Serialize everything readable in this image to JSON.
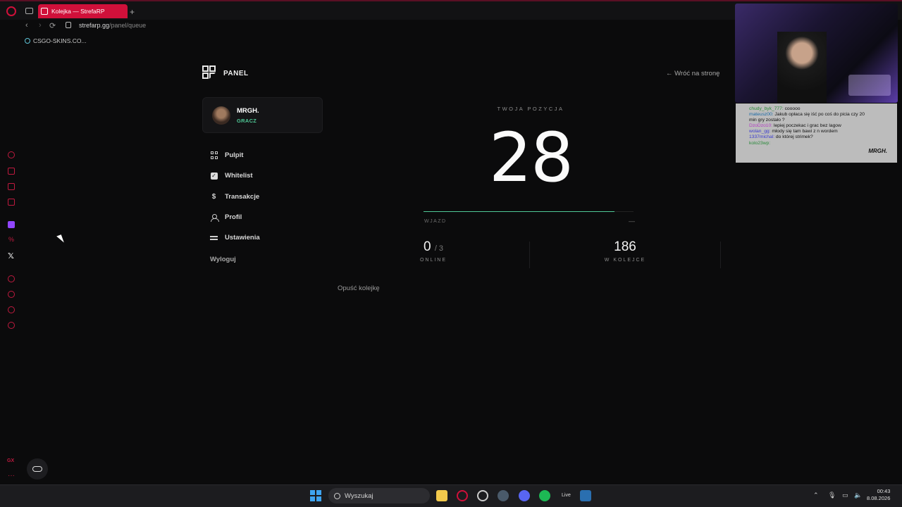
{
  "browser": {
    "tab_title": "Kolejka — StrefaRP",
    "new_tab_symbol": "+",
    "url_domain": "strefarp.gg",
    "url_path": "/panel/queue",
    "bookmark": "CSGO-SKINS.CO..."
  },
  "panel": {
    "brand": "PANEL",
    "back_link": "← Wróć na stronę",
    "user": {
      "name": "MRGH.",
      "role": "GRACZ"
    },
    "menu": [
      {
        "label": "Pulpit",
        "icon": "grid-icon"
      },
      {
        "label": "Whitelist",
        "icon": "checkbox-icon"
      },
      {
        "label": "Transakcje",
        "icon": "dollar-icon"
      },
      {
        "label": "Profil",
        "icon": "user-icon"
      },
      {
        "label": "Ustawienia",
        "icon": "sliders-icon"
      }
    ],
    "logout": "Wyloguj"
  },
  "queue": {
    "position_label": "TWOJA POZYCJA",
    "position": "28",
    "progress_fraction": 0.91,
    "entry_label": "WJAZD",
    "entry_value": "—",
    "online_value": "0",
    "online_max": "/ 3",
    "online_label": "ONLINE",
    "in_queue_value": "186",
    "in_queue_label": "W KOLEJCE",
    "leave": "Opuść kolejkę"
  },
  "stream_chat": {
    "messages": [
      {
        "user": "chudy_byk_777:",
        "text": " cooooo",
        "cls": "u1"
      },
      {
        "user": "mateusz00:",
        "text": " Jakub opłaca się iść po coś do picia czy 20",
        "cls": "u2"
      },
      {
        "user": "",
        "text": "min gry zostało ?",
        "cls": ""
      },
      {
        "user": "DzoDzo10:",
        "text": " lepiej poczekac i grac bez lagow",
        "cls": "u3"
      },
      {
        "user": "wolan_gg:",
        "text": " młody się tam bawi z n wordem",
        "cls": "u4"
      },
      {
        "user": "1337michal:",
        "text": " do której strimek?",
        "cls": "u4"
      },
      {
        "user": "kolo23wp:",
        "text": " ",
        "cls": "u1"
      }
    ],
    "badge": "MRGH."
  },
  "taskbar": {
    "search_placeholder": "Wyszukaj",
    "live_label": "Live",
    "time": "00:43",
    "date": "8.08.2026"
  },
  "colors": {
    "accent_green": "#4fc896",
    "opera_red": "#d0103a",
    "background": "#0b0b0c"
  }
}
